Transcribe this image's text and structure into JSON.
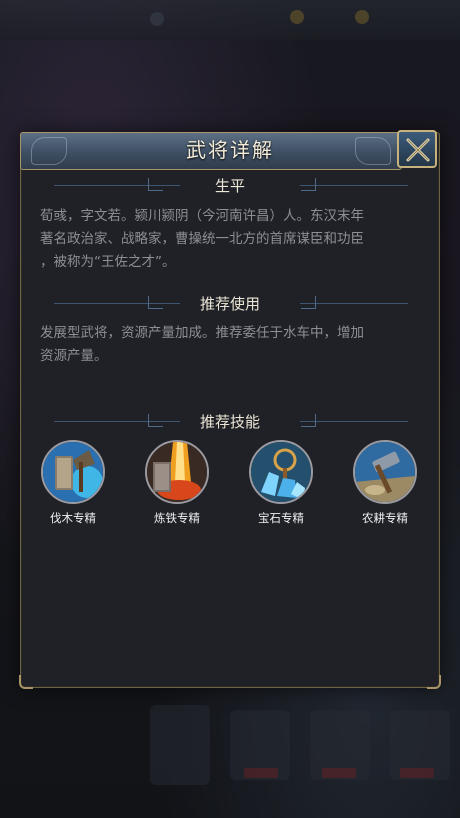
{
  "dialog": {
    "title": "武将详解",
    "close_icon": "close-x-icon"
  },
  "sections": {
    "biography": {
      "heading": "生平",
      "text_lines": [
        "荀彧，字文若。颍川颍阴（今河南许昌）人。东汉末年",
        "著名政治家、战略家，曹操统一北方的首席谋臣和功臣",
        "，被称为“王佐之才”。"
      ]
    },
    "usage": {
      "heading": "推荐使用",
      "text_lines": [
        "发展型武将，资源产量加成。推荐委任于水车中，增加",
        "资源产量。"
      ]
    },
    "skills": {
      "heading": "推荐技能",
      "items": [
        {
          "name": "伐木专精",
          "icon": "lumber-axe-icon"
        },
        {
          "name": "炼铁专精",
          "icon": "iron-smelting-icon"
        },
        {
          "name": "宝石专精",
          "icon": "gem-icon"
        },
        {
          "name": "农耕专精",
          "icon": "farming-hammer-icon"
        }
      ]
    }
  },
  "colors": {
    "panel_bg": "#1f2127",
    "header_bg": "#3e4f63",
    "gold_border": "#a8956a",
    "body_text": "#8d8f95",
    "heading_text": "#ece6d6"
  }
}
